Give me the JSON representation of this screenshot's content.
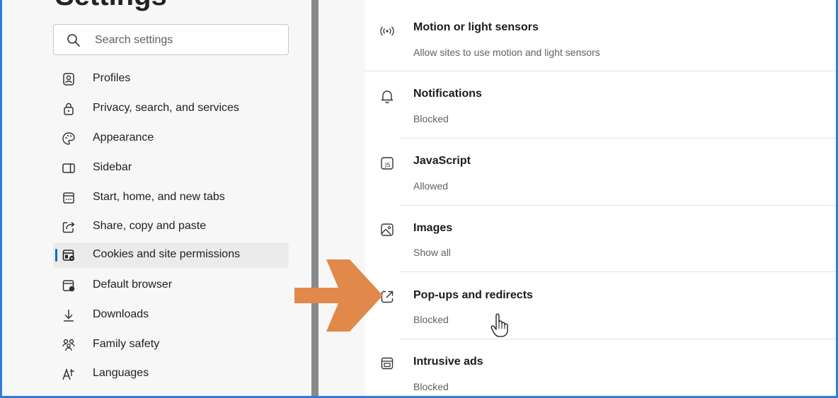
{
  "sidebar": {
    "title": "Settings",
    "search": {
      "placeholder": "Search settings",
      "value": ""
    },
    "items": [
      {
        "label": "Profiles",
        "icon": "profile-icon"
      },
      {
        "label": "Privacy, search, and services",
        "icon": "lock-icon"
      },
      {
        "label": "Appearance",
        "icon": "palette-icon"
      },
      {
        "label": "Sidebar",
        "icon": "sidebar-icon"
      },
      {
        "label": "Start, home, and new tabs",
        "icon": "home-tabs-icon"
      },
      {
        "label": "Share, copy and paste",
        "icon": "share-icon"
      },
      {
        "label": "Cookies and site permissions",
        "icon": "cookies-icon",
        "selected": true
      },
      {
        "label": "Default browser",
        "icon": "browser-icon"
      },
      {
        "label": "Downloads",
        "icon": "download-icon"
      },
      {
        "label": "Family safety",
        "icon": "family-icon"
      },
      {
        "label": "Languages",
        "icon": "languages-icon"
      }
    ]
  },
  "permissions": [
    {
      "title": "Motion or light sensors",
      "subtitle": "Allow sites to use motion and light sensors",
      "icon": "sensor-icon"
    },
    {
      "title": "Notifications",
      "subtitle": "Blocked",
      "icon": "bell-icon"
    },
    {
      "title": "JavaScript",
      "subtitle": "Allowed",
      "icon": "javascript-icon"
    },
    {
      "title": "Images",
      "subtitle": "Show all",
      "icon": "image-icon"
    },
    {
      "title": "Pop-ups and redirects",
      "subtitle": "Blocked",
      "icon": "popup-icon"
    },
    {
      "title": "Intrusive ads",
      "subtitle": "Blocked",
      "icon": "ads-icon"
    }
  ],
  "colors": {
    "accent": "#0f6cbd",
    "annotation_arrow": "#e0894a",
    "frame": "#2f7fd6"
  }
}
